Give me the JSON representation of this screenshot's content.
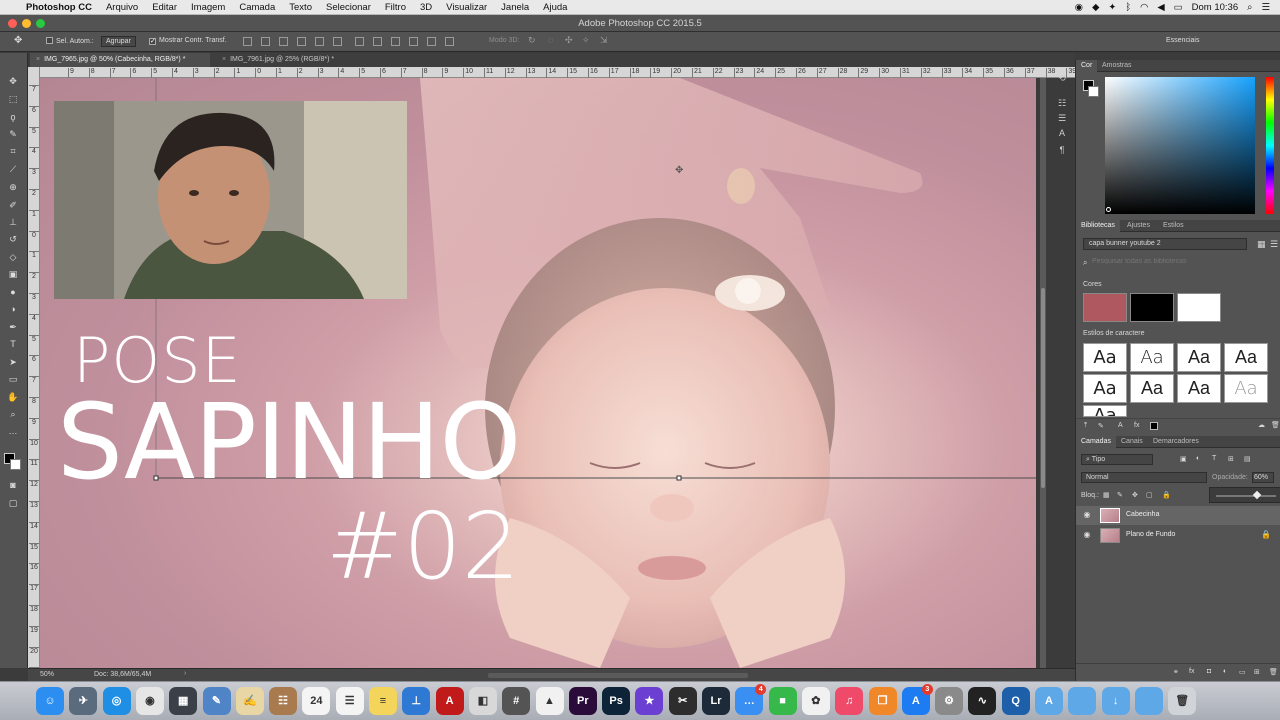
{
  "menubar": {
    "apple_icon": "apple-icon",
    "app_name": "Photoshop CC",
    "items": [
      "Arquivo",
      "Editar",
      "Imagem",
      "Camada",
      "Texto",
      "Selecionar",
      "Filtro",
      "3D",
      "Visualizar",
      "Janela",
      "Ajuda"
    ],
    "clock": "Dom 10:36"
  },
  "window": {
    "title": "Adobe Photoshop CC 2015.5"
  },
  "options_bar": {
    "auto_select_label": "Sel. Autom.:",
    "auto_select_value": "Agrupar",
    "show_transform_label": "Mostrar Contr. Transf.",
    "mode_3d_label": "Modo 3D:",
    "workspace": "Essenciais"
  },
  "tabs": [
    {
      "label": "IMG_7965.jpg @ 50% (Cabecinha, RGB/8*) *",
      "active": true
    },
    {
      "label": "IMG_7961.jpg @ 25% (RGB/8*) *",
      "active": false
    }
  ],
  "ruler": {
    "top_ticks": [
      "9",
      "8",
      "7",
      "6",
      "5",
      "4",
      "3",
      "2",
      "1",
      "0",
      "1",
      "2",
      "3",
      "4",
      "5",
      "6",
      "7",
      "8",
      "9",
      "10",
      "11",
      "12",
      "13",
      "14",
      "15",
      "16",
      "17",
      "18",
      "19",
      "20",
      "21",
      "22",
      "23",
      "24",
      "25",
      "26",
      "27",
      "28",
      "29",
      "30",
      "31",
      "32",
      "33",
      "34",
      "35",
      "36",
      "37",
      "38",
      "39"
    ],
    "left_ticks": [
      "7",
      "6",
      "5",
      "4",
      "3",
      "2",
      "1",
      "0",
      "1",
      "2",
      "3",
      "4",
      "5",
      "6",
      "7",
      "8",
      "9",
      "10",
      "11",
      "12",
      "13",
      "14",
      "15",
      "16",
      "17",
      "18",
      "19",
      "20",
      "21"
    ]
  },
  "poster": {
    "line1": "POSE",
    "line2": "SAPINHO",
    "line3": "#02"
  },
  "status": {
    "zoom": "50%",
    "doc": "Doc: 38,6M/65,4M"
  },
  "color_panel": {
    "tabs": [
      "Cor",
      "Amostras"
    ]
  },
  "libraries_panel": {
    "tabs": [
      "Bibliotecas",
      "Ajustes",
      "Estilos"
    ],
    "library": "capa bunner youtube 2",
    "search_placeholder": "Pesquisar todas as bibliotecas",
    "colors_heading": "Cores",
    "colors": [
      "#b05860",
      "#000000",
      "#ffffff"
    ],
    "char_styles_heading": "Estilos de caractere",
    "char_styles": [
      "Aa",
      "Aa",
      "Aa",
      "Aa",
      "Aa",
      "Aa",
      "Aa",
      "Aa",
      "Aa"
    ]
  },
  "layers_panel": {
    "tabs": [
      "Camadas",
      "Canais",
      "Demarcadores"
    ],
    "filter_kind": "Tipo",
    "blend_mode": "Normal",
    "opacity_label": "Opacidade:",
    "opacity_value": "60%",
    "lock_label": "Bloq.:",
    "layers": [
      {
        "name": "Cabecinha",
        "selected": true,
        "locked": false
      },
      {
        "name": "Plano de Fundo",
        "selected": false,
        "locked": true
      }
    ]
  },
  "dock": {
    "apps": [
      {
        "name": "finder-icon",
        "color": "#2b8ef0",
        "glyph": "☺"
      },
      {
        "name": "launchpad-icon",
        "color": "#5a6b7d",
        "glyph": "✈"
      },
      {
        "name": "safari-icon",
        "color": "#1f8fe6",
        "glyph": "◎"
      },
      {
        "name": "chrome-icon",
        "color": "#e6e6e6",
        "glyph": "◉"
      },
      {
        "name": "photo-booth-icon",
        "color": "#3a3f48",
        "glyph": "▦"
      },
      {
        "name": "preview-icon",
        "color": "#4f84c7",
        "glyph": "✎"
      },
      {
        "name": "textedit-icon",
        "color": "#e8d7a4",
        "glyph": "✍"
      },
      {
        "name": "contacts-icon",
        "color": "#a87a4e",
        "glyph": "☷"
      },
      {
        "name": "calendar-icon",
        "color": "#f4f4f4",
        "glyph": "24"
      },
      {
        "name": "reminders-icon",
        "color": "#f4f4f4",
        "glyph": "☰"
      },
      {
        "name": "notes-icon",
        "color": "#f3d55b",
        "glyph": "≡"
      },
      {
        "name": "keynote-icon",
        "color": "#2e79d4",
        "glyph": "⊥"
      },
      {
        "name": "acrobat-icon",
        "color": "#c11a1a",
        "glyph": "A"
      },
      {
        "name": "archive-utility-icon",
        "color": "#d8d8d8",
        "glyph": "◧"
      },
      {
        "name": "calculator-icon",
        "color": "#545454",
        "glyph": "#"
      },
      {
        "name": "google-drive-icon",
        "color": "#f1f1f1",
        "glyph": "▲"
      },
      {
        "name": "premiere-icon",
        "color": "#2a0b3a",
        "glyph": "Pr"
      },
      {
        "name": "photoshop-icon",
        "color": "#0d2338",
        "glyph": "Ps"
      },
      {
        "name": "imovie-icon",
        "color": "#6a3fd1",
        "glyph": "★"
      },
      {
        "name": "final-cut-icon",
        "color": "#2d2d2d",
        "glyph": "✂"
      },
      {
        "name": "lightroom-icon",
        "color": "#1d2a3a",
        "glyph": "Lr"
      },
      {
        "name": "messages-icon",
        "color": "#3a90f2",
        "glyph": "…"
      },
      {
        "name": "facetime-icon",
        "color": "#36b84a",
        "glyph": "■"
      },
      {
        "name": "photos-icon",
        "color": "#f1f1f1",
        "glyph": "✿"
      },
      {
        "name": "itunes-icon",
        "color": "#f04a6a",
        "glyph": "♫"
      },
      {
        "name": "ibooks-icon",
        "color": "#f0882a",
        "glyph": "❒"
      },
      {
        "name": "app-store-icon",
        "color": "#1d7cf2",
        "glyph": "A"
      },
      {
        "name": "system-preferences-icon",
        "color": "#8a8a8a",
        "glyph": "⚙"
      },
      {
        "name": "activity-monitor-icon",
        "color": "#222",
        "glyph": "∿"
      },
      {
        "name": "quicktime-icon",
        "color": "#1d5fa8",
        "glyph": "Q"
      },
      {
        "name": "folder-apps-icon",
        "color": "#5fa8e8",
        "glyph": "A"
      },
      {
        "name": "folder-documents-icon",
        "color": "#5fa8e8",
        "glyph": ""
      },
      {
        "name": "folder-downloads-icon",
        "color": "#5fa8e8",
        "glyph": "↓"
      },
      {
        "name": "folder-desktop-icon",
        "color": "#5fa8e8",
        "glyph": ""
      },
      {
        "name": "trash-icon",
        "color": "#d0d3d8",
        "glyph": "🗑"
      }
    ],
    "badges": {
      "messages-icon": "4",
      "app-store-icon": "3"
    }
  }
}
